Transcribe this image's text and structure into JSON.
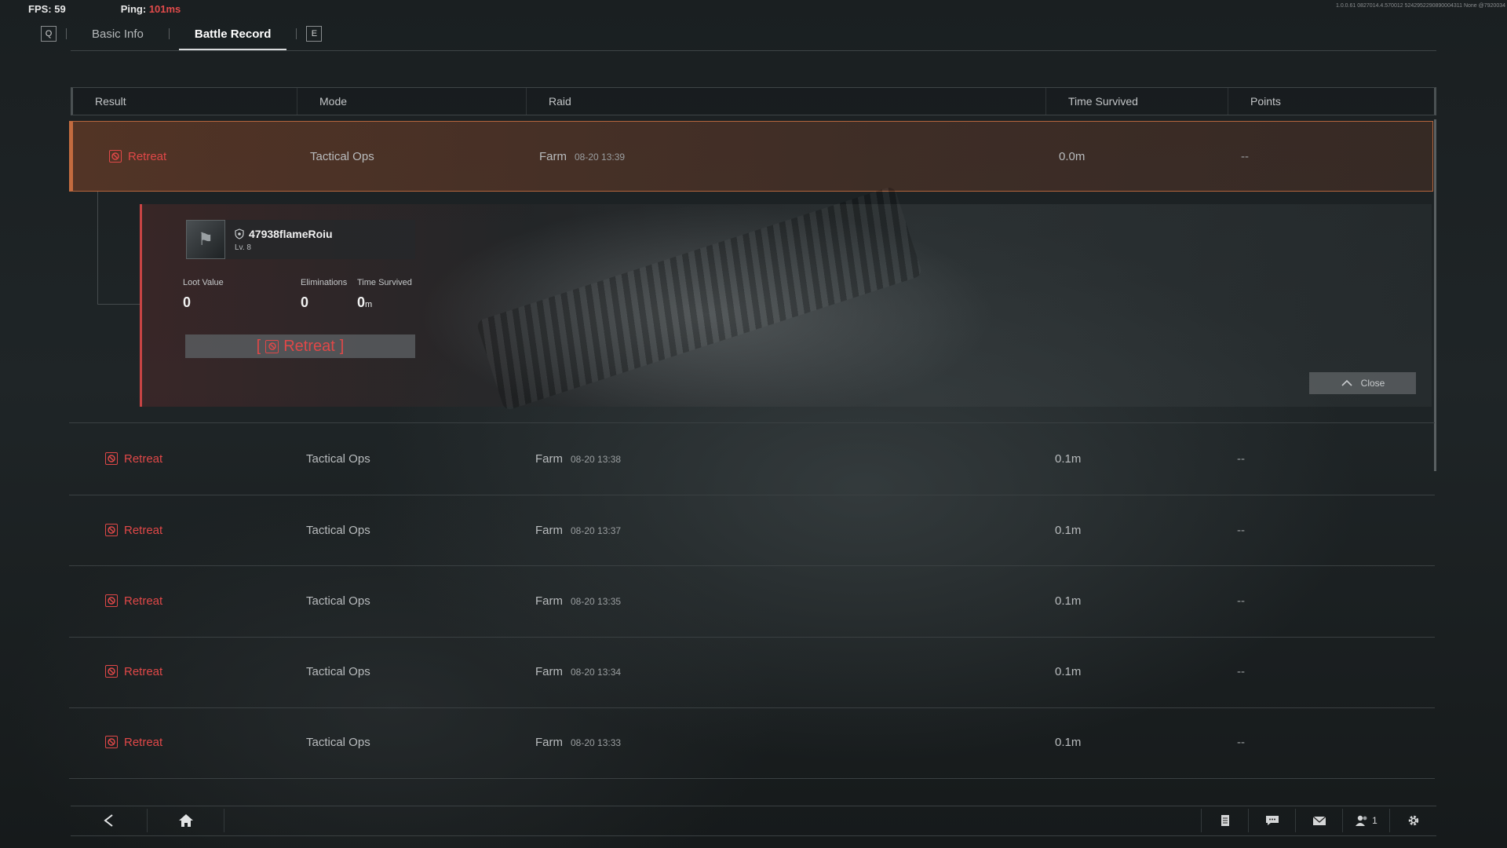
{
  "hud": {
    "fps_label": "FPS: 59",
    "ping_label": "Ping:",
    "ping_value": "101ms",
    "build": "1.0.0.61 0827014.4.570012 5242952290890004311 None @7920034"
  },
  "tabs": {
    "left_key": "Q",
    "right_key": "E",
    "items": [
      "Basic Info",
      "Battle Record"
    ],
    "active": "Battle Record"
  },
  "table": {
    "headers": {
      "result": "Result",
      "mode": "Mode",
      "raid": "Raid",
      "time": "Time Survived",
      "points": "Points"
    },
    "rows": [
      {
        "result": "Retreat",
        "mode": "Tactical Ops",
        "raid": "Farm",
        "date": "08-20 13:39",
        "time": "0.0m",
        "points": "--"
      },
      {
        "result": "Retreat",
        "mode": "Tactical Ops",
        "raid": "Farm",
        "date": "08-20 13:38",
        "time": "0.1m",
        "points": "--"
      },
      {
        "result": "Retreat",
        "mode": "Tactical Ops",
        "raid": "Farm",
        "date": "08-20 13:37",
        "time": "0.1m",
        "points": "--"
      },
      {
        "result": "Retreat",
        "mode": "Tactical Ops",
        "raid": "Farm",
        "date": "08-20 13:35",
        "time": "0.1m",
        "points": "--"
      },
      {
        "result": "Retreat",
        "mode": "Tactical Ops",
        "raid": "Farm",
        "date": "08-20 13:34",
        "time": "0.1m",
        "points": "--"
      },
      {
        "result": "Retreat",
        "mode": "Tactical Ops",
        "raid": "Farm",
        "date": "08-20 13:33",
        "time": "0.1m",
        "points": "--"
      }
    ]
  },
  "detail": {
    "player_name": "47938flameRoiu",
    "level": "Lv. 8",
    "loot_label": "Loot Value",
    "loot_value": "0",
    "elim_label": "Eliminations",
    "elim_value": "0",
    "time_label": "Time Survived",
    "time_value": "0",
    "time_unit": "m",
    "banner_open": "[",
    "banner_text": "Retreat",
    "banner_close": "]",
    "close_label": "Close"
  },
  "bottom": {
    "friends_count": "1"
  },
  "colors": {
    "accent_red": "#e04848",
    "selected_border": "#c26b3f"
  }
}
